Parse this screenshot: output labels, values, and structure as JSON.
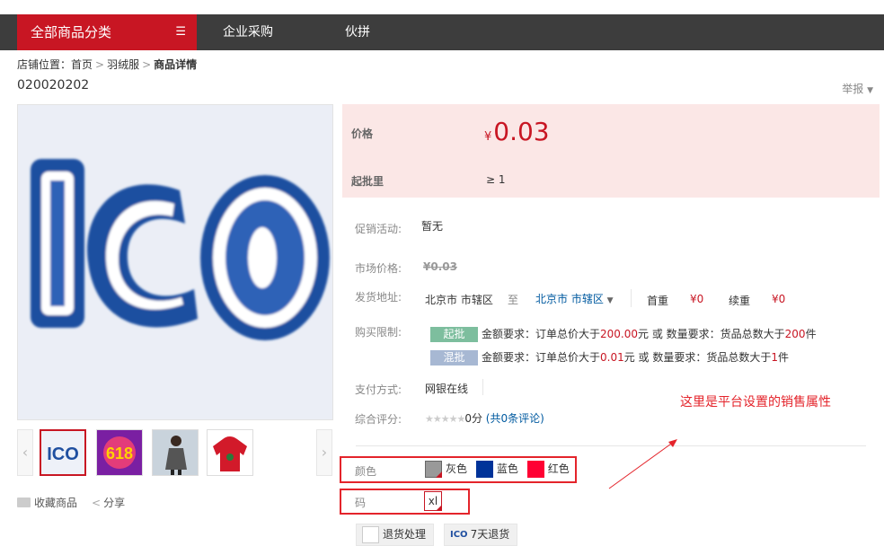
{
  "nav": {
    "category_label": "全部商品分类",
    "links": [
      "企业采购",
      "伙拼"
    ]
  },
  "breadcrumb": {
    "prefix": "店铺位置：",
    "items": [
      "首页",
      "羽绒服"
    ],
    "current": "商品详情"
  },
  "product": {
    "code": "020020202",
    "report": "举报",
    "main_image": "ICO",
    "thumb_labels": [
      "ICO",
      "618"
    ],
    "fav": "收藏商品",
    "share": "分享"
  },
  "price": {
    "price_label": "价格",
    "currency": "¥",
    "value": "0.03",
    "moq_label": "起批里",
    "moq": "≥ 1"
  },
  "details": {
    "promo_label": "促销活动:",
    "promo_value": "暂无",
    "market_label": "市场价格:",
    "market_value": "¥0.03",
    "ship_label": "发货地址:",
    "ship_from": "北京市 市辖区",
    "ship_to_word": "至",
    "ship_to": "北京市 市辖区",
    "first_weight_label": "首重",
    "first_weight": "¥0",
    "continue_weight_label": "续重",
    "continue_weight": "¥0",
    "limit_label": "购买限制:",
    "limit1_tag": "起批",
    "limit1_a": "金额要求：订单总价大于",
    "limit1_amount": "200.00",
    "limit1_b": "元 或 数量要求：货品总数大于",
    "limit1_qty": "200",
    "limit1_c": "件",
    "limit2_tag": "混批",
    "limit2_a": "金额要求：订单总价大于",
    "limit2_amount": "0.01",
    "limit2_b": "元 或 数量要求：货品总数大于",
    "limit2_qty": "1",
    "limit2_c": "件",
    "pay_label": "支付方式:",
    "pay_value": "网银在线",
    "rating_label": "综合评分:",
    "rating_stars": "★★★★★",
    "rating_score": "0分",
    "rating_reviews": "(共0条评论)"
  },
  "attrs": {
    "color_label": "颜色",
    "colors": [
      {
        "name": "灰色",
        "hex": "#999999"
      },
      {
        "name": "蓝色",
        "hex": "#003399"
      },
      {
        "name": "红色",
        "hex": "#ff0033"
      }
    ],
    "size_label": "码",
    "size_value": "xl"
  },
  "annotation": "这里是平台设置的销售属性",
  "services": {
    "return_label": "退货处理",
    "seven_day_icon": "ICO",
    "seven_day": "7天退货"
  },
  "colors": {
    "brand_red": "#c81623",
    "nav_dark": "#3d3d3d",
    "price_bg": "#fbe7e6"
  }
}
